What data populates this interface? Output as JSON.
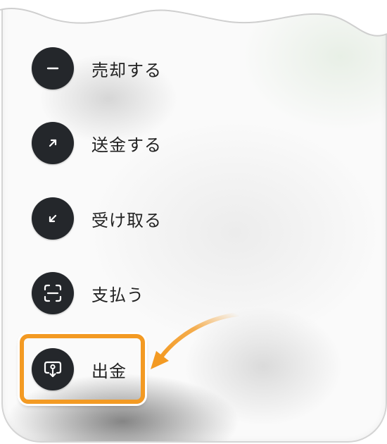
{
  "menu": {
    "items": [
      {
        "icon": "minus-icon",
        "label": "売却する"
      },
      {
        "icon": "arrow-up-right-icon",
        "label": "送金する"
      },
      {
        "icon": "arrow-down-left-icon",
        "label": "受け取る"
      },
      {
        "icon": "scan-icon",
        "label": "支払う"
      },
      {
        "icon": "withdraw-icon",
        "label": "出金"
      }
    ]
  },
  "highlight": {
    "target": "withdraw",
    "color": "#f39a23"
  },
  "colors": {
    "icon_bg": "#24272b",
    "accent": "#f39a23",
    "text": "#222222"
  }
}
